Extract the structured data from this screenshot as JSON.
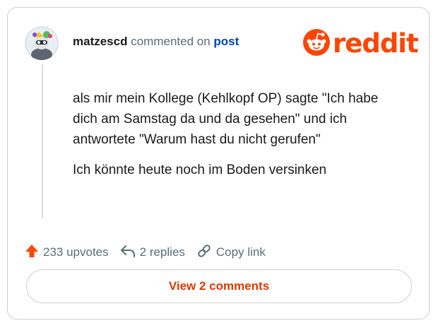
{
  "comment": {
    "username": "matzescd",
    "action_text": "commented on",
    "target_link": "post",
    "body": [
      "als mir mein Kollege (Kehlkopf OP) sagte \"Ich habe dich am Samstag da und da gesehen\" und ich antwortete \"Warum hast du nicht gerufen\"",
      "Ich könnte heute noch im Boden versinken"
    ]
  },
  "brand": {
    "logo_icon": "reddit-snoo-icon",
    "logo_text": "reddit",
    "accent_color": "#ff4500"
  },
  "actions": {
    "upvotes": "233 upvotes",
    "upvote_icon": "upvote-arrow-icon",
    "replies": "2 replies",
    "reply_icon": "reply-arrow-icon",
    "copy_link": "Copy link",
    "copy_icon": "link-icon"
  },
  "view_comments_label": "View 2 comments",
  "colors": {
    "link_blue": "#0045ac",
    "muted_gray": "#576f76",
    "button_text": "#d93a00"
  }
}
